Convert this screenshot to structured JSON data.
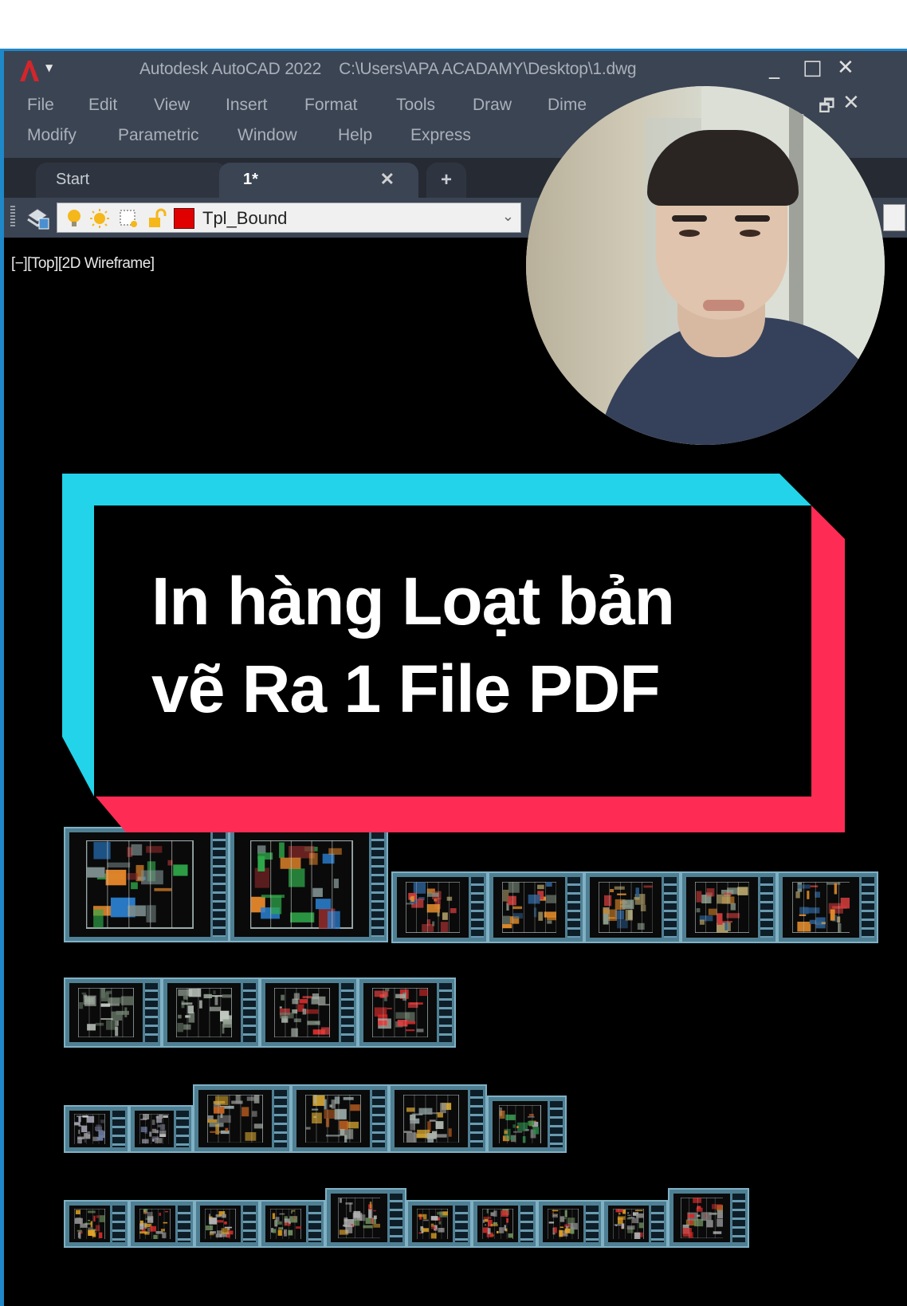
{
  "window": {
    "app_title": "Autodesk AutoCAD 2022",
    "file_path": "C:\\Users\\APA ACADAMY\\Desktop\\1.dwg",
    "app_icon": "autocad-logo-icon",
    "controls": {
      "minimize": "_",
      "maximize": "□",
      "close": "✕"
    },
    "doc_controls": {
      "minimize": "_",
      "restore": "🗗",
      "close": "✕"
    }
  },
  "menubar": {
    "row1": [
      "File",
      "Edit",
      "View",
      "Insert",
      "Format",
      "Tools",
      "Draw",
      "Dime"
    ],
    "row2": [
      "Modify",
      "Parametric",
      "Window",
      "Help",
      "Express"
    ]
  },
  "tabs": {
    "items": [
      {
        "label": "Start",
        "active": false
      },
      {
        "label": "1*",
        "active": true
      }
    ],
    "close_glyph": "✕",
    "add_glyph": "+"
  },
  "layer_toolbar": {
    "current_layer": "Tpl_Bound",
    "layer_color": "#e00000",
    "icons": [
      "layer-on-bulb-icon",
      "layer-thaw-sun-icon",
      "layer-viewport-freeze-icon",
      "layer-unlock-icon",
      "layer-color-swatch-icon"
    ],
    "dropdown_caret": "⌄"
  },
  "viewport": {
    "label": "[−][Top][2D Wireframe]",
    "background": "#000000"
  },
  "overlay": {
    "banner_line1": "In hàng Loạt bản",
    "banner_line2": "vẽ Ra 1 File PDF",
    "accent_cyan": "#22d3e9",
    "accent_red": "#fe2c55",
    "webcam_alt": "presenter webcam feed"
  },
  "drawing_sheets": {
    "rows": [
      {
        "row": 1,
        "count": 7,
        "content": "site and floor plans"
      },
      {
        "row": 2,
        "count": 4,
        "content": "floor plans"
      },
      {
        "row": 3,
        "count": 6,
        "content": "elevations and sections"
      },
      {
        "row": 4,
        "count": 10,
        "content": "detail sheets"
      }
    ]
  }
}
